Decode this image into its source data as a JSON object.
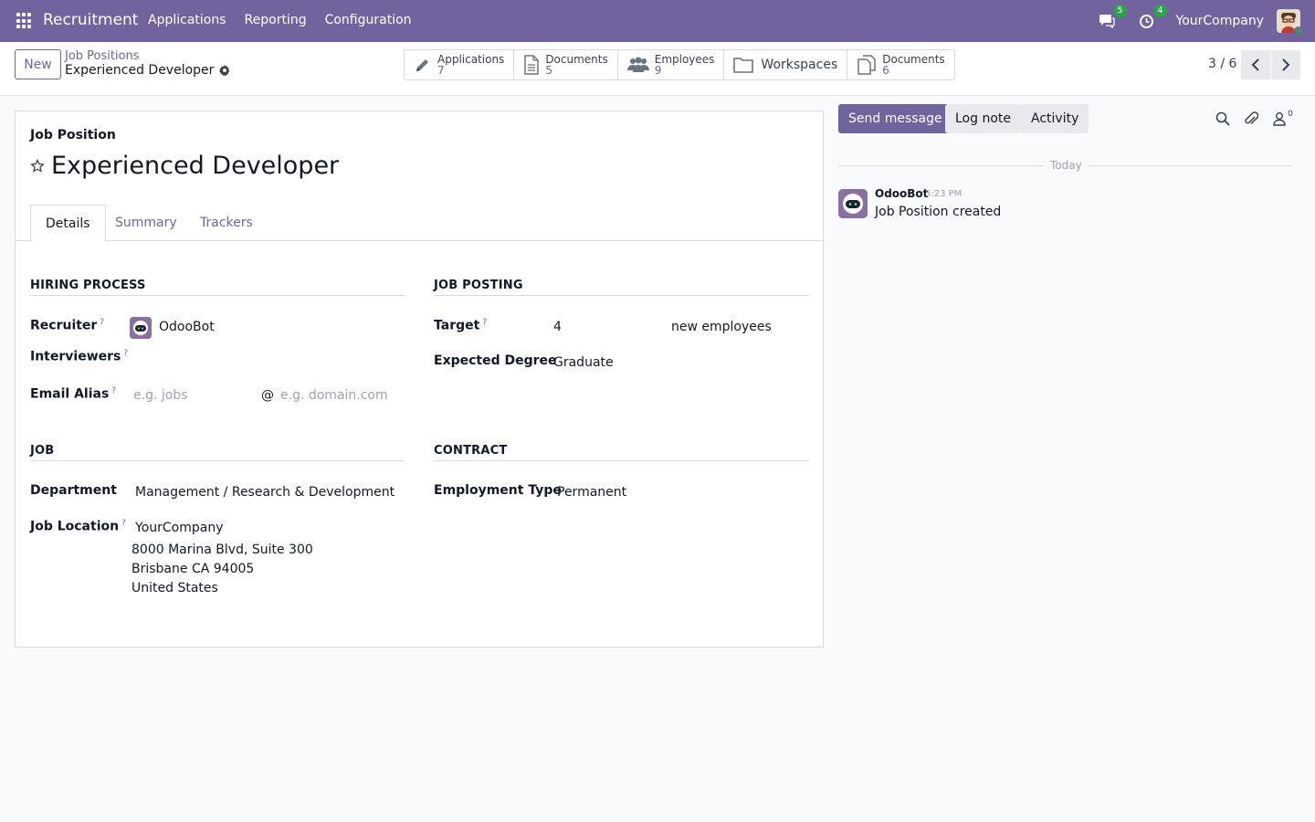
{
  "navbar": {
    "app_name": "Recruitment",
    "menu": [
      "Applications",
      "Reporting",
      "Configuration"
    ],
    "messages_count": "5",
    "activities_count": "4",
    "company": "YourCompany"
  },
  "control": {
    "new_label": "New",
    "breadcrumb_parent": "Job Positions",
    "breadcrumb_current": "Experienced Developer",
    "smart_buttons": [
      {
        "label": "Applications",
        "value": "7",
        "icon": "pencil-icon"
      },
      {
        "label": "Documents",
        "value": "5",
        "icon": "document-icon"
      },
      {
        "label": "Employees",
        "value": "9",
        "icon": "users-icon"
      },
      {
        "label": "Workspaces",
        "icon": "folder-icon"
      },
      {
        "label": "Documents",
        "value": "6",
        "icon": "documents-icon"
      }
    ],
    "pager": "3 / 6"
  },
  "form": {
    "type_label": "Job Position",
    "title": "Experienced Developer",
    "tabs": [
      "Details",
      "Summary",
      "Trackers"
    ],
    "hiring_process": {
      "section_title": "HIRING PROCESS",
      "recruiter_label": "Recruiter",
      "recruiter_value": "OdooBot",
      "interviewers_label": "Interviewers",
      "email_alias_label": "Email Alias",
      "email_alias_placeholder": "e.g. jobs",
      "at_sign": "@",
      "domain_placeholder": "e.g. domain.com"
    },
    "job_posting": {
      "section_title": "JOB POSTING",
      "target_label": "Target",
      "target_value": "4",
      "target_unit": "new employees",
      "degree_label": "Expected Degree",
      "degree_value": "Graduate"
    },
    "job": {
      "section_title": "JOB",
      "department_label": "Department",
      "department_value": "Management / Research & Development",
      "location_label": "Job Location",
      "location_company": "YourCompany",
      "address_line1": "8000 Marina Blvd, Suite 300",
      "address_line2": "Brisbane CA 94005",
      "address_line3": "United States"
    },
    "contract": {
      "section_title": "CONTRACT",
      "employment_type_label": "Employment Type",
      "employment_type_value": "Permanent"
    },
    "help_mark": "?"
  },
  "chatter": {
    "send_message": "Send message",
    "log_note": "Log note",
    "activity": "Activity",
    "followers_count": "0",
    "date_separator": "Today",
    "messages": [
      {
        "author": "OdooBot",
        "time": "5:23 PM",
        "body": "Job Position created"
      }
    ]
  },
  "colors": {
    "brand": "#71639e",
    "badge": "#28a745"
  }
}
